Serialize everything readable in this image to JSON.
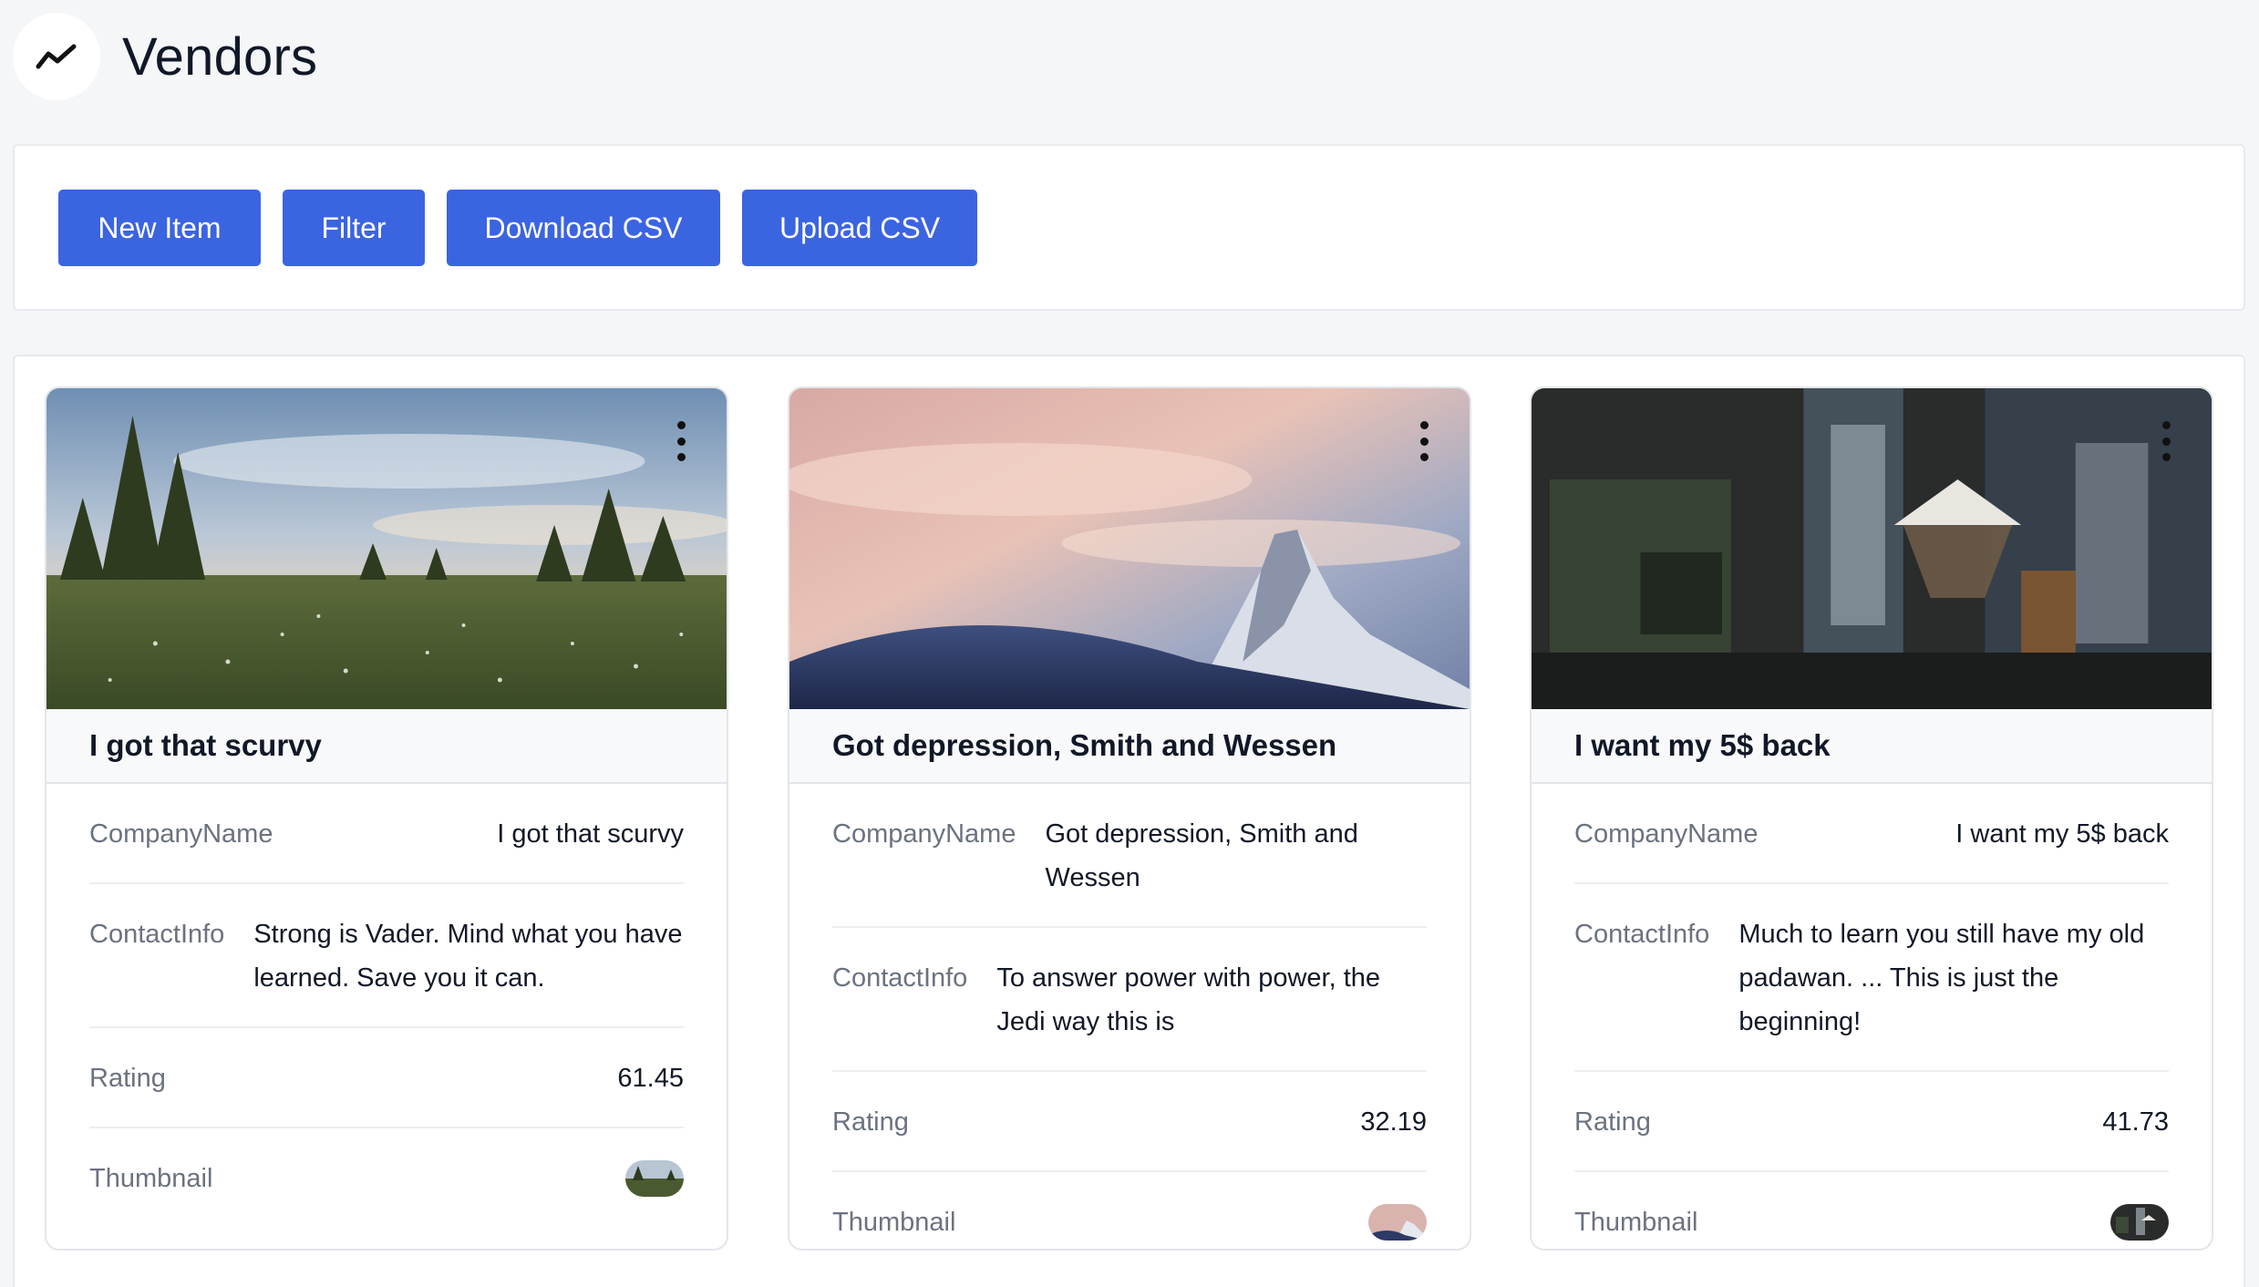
{
  "page": {
    "title": "Vendors",
    "logo_icon": "trend-line-icon"
  },
  "toolbar": {
    "buttons": [
      {
        "label": "New Item"
      },
      {
        "label": "Filter"
      },
      {
        "label": "Download CSV"
      },
      {
        "label": "Upload CSV"
      }
    ],
    "button_color": "#3b64e0"
  },
  "cards": [
    {
      "title": "I got that scurvy",
      "image": "meadow-with-pine-trees",
      "fields": {
        "company_label": "CompanyName",
        "company": "I got that scurvy",
        "contact_label": "ContactInfo",
        "contact": "Strong is Vader. Mind what you have learned. Save you it can.",
        "rating_label": "Rating",
        "rating": "61.45",
        "thumbnail_label": "Thumbnail"
      }
    },
    {
      "title": "Got depression, Smith and Wessen",
      "image": "snowy-mountain-peak-at-dusk",
      "fields": {
        "company_label": "CompanyName",
        "company": "Got depression, Smith and Wessen",
        "contact_label": "ContactInfo",
        "contact": "To answer power with power, the Jedi way this is",
        "rating_label": "Rating",
        "rating": "32.19",
        "thumbnail_label": "Thumbnail"
      }
    },
    {
      "title": "I want my 5$ back",
      "image": "coffee-brewing-equipment",
      "fields": {
        "company_label": "CompanyName",
        "company": "I want my 5$ back",
        "contact_label": "ContactInfo",
        "contact": "Much to learn you still have my old padawan. ... This is just the beginning!",
        "rating_label": "Rating",
        "rating": "41.73",
        "thumbnail_label": "Thumbnail"
      }
    }
  ]
}
